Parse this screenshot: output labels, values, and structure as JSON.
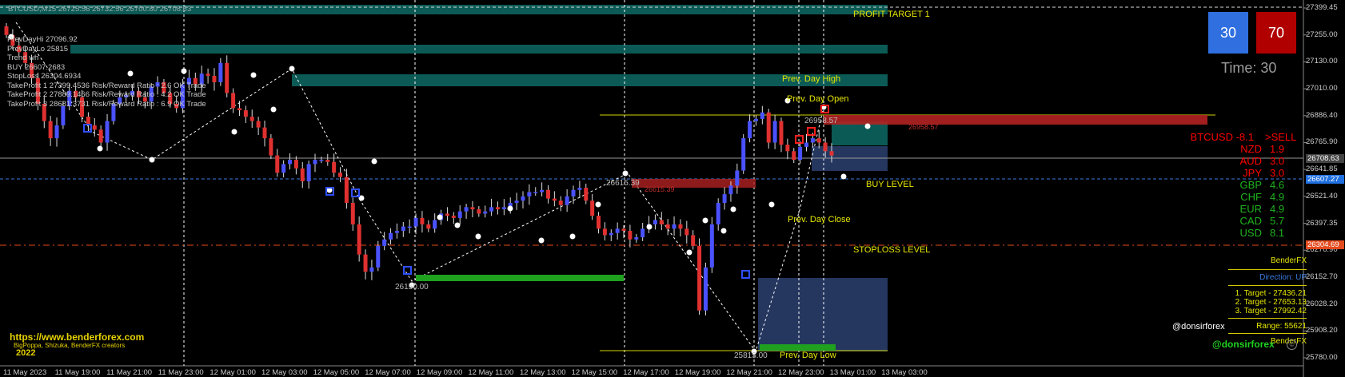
{
  "window": {
    "top_info": "BTCUSD,M15 26725.56 26732.56 26700.80 26708.63"
  },
  "indicator_text": {
    "lines": [
      "PrevDayHi 27096.92",
      "PrevDayLo 25815",
      "Trend wh",
      "BUY 26607.2683",
      "StopLoss 26304.6934",
      "TakeProfit 1 27399.4536 Risk/Reward Ratio : 2.6 OK Trade",
      "TakeProfit 2 27889.1466 Risk/Reward Ratio : 4.2 OK Trade",
      "TakeProfit 3 28681.3731 Risk/Reward Ratio : 6.9 OK Trade"
    ]
  },
  "levels": {
    "profit_target_label": "PROFIT TARGET 1",
    "prev_day_high_label": "Prev. Day High",
    "prev_day_open_label": "Prev. Day Open",
    "prev_day_close_label": "Prev. Day Close",
    "prev_day_low_label": "Prev. Day Low",
    "buy_level_label": "BUY LEVEL",
    "stoploss_label": "STOPLOSS LEVEL"
  },
  "zigzag_labels": {
    "high_1": "26958.57",
    "high_2": "26615.39",
    "low_1": "26150.00",
    "low_2": "25815.00"
  },
  "signal_text": {
    "sell_cluster": "26958.57",
    "mid_cluster": "26615.39"
  },
  "timer": {
    "buy_count": "30",
    "sell_count": "70",
    "time_label": "Time: 30",
    "buy_color": "#2f6fe0",
    "sell_color": "#b00000"
  },
  "strength": [
    {
      "name": "BTCUSD -8.1",
      "value": ">SELL",
      "color": "#ff0000"
    },
    {
      "name": "NZD",
      "value": "1.9",
      "color": "#ff0000"
    },
    {
      "name": "AUD",
      "value": "3.0",
      "color": "#ff0000"
    },
    {
      "name": "JPY",
      "value": "3.0",
      "color": "#ff0000"
    },
    {
      "name": "GBP",
      "value": "4.6",
      "color": "#1fb21f"
    },
    {
      "name": "CHF",
      "value": "4.9",
      "color": "#1fb21f"
    },
    {
      "name": "EUR",
      "value": "4.9",
      "color": "#1fb21f"
    },
    {
      "name": "CAD",
      "value": "5.7",
      "color": "#1fb21f"
    },
    {
      "name": "USD",
      "value": "8.1",
      "color": "#1fb21f"
    }
  ],
  "benderfx": {
    "title": "BenderFX",
    "direction": "Direction: UP",
    "target1": "1. Target - 27436.21",
    "target2": "2. Target - 27653.13",
    "target3": "3. Target - 27992.42",
    "range": "Range: 55621",
    "footer": "BenderFX",
    "handle_white": "@donsirforex",
    "handle_green": "@donsirforex"
  },
  "branding": {
    "url": "https://www.benderforex.com",
    "creators": "BigPoppa, Shizuka, BenderFX creators",
    "year": "2022"
  },
  "price_axis": {
    "labels": [
      "27399.45",
      "27255.00",
      "27130.00",
      "27010.00",
      "26886.40",
      "26765.90",
      "26641.85",
      "26521.40",
      "26397.35",
      "26276.90",
      "26152.70",
      "26028.20",
      "25908.20",
      "25780.00"
    ],
    "current_price": "26708.63",
    "buy_price": "26607.27",
    "stop_price": "26304.69"
  },
  "time_axis": {
    "labels": [
      "11 May 2023",
      "11 May 19:00",
      "11 May 21:00",
      "11 May 23:00",
      "12 May 01:00",
      "12 May 03:00",
      "12 May 05:00",
      "12 May 07:00",
      "12 May 09:00",
      "12 May 11:00",
      "12 May 13:00",
      "12 May 15:00",
      "12 May 17:00",
      "12 May 19:00",
      "12 May 21:00",
      "12 May 23:00",
      "13 May 01:00",
      "13 May 03:00"
    ]
  },
  "chart_data": {
    "type": "candlestick",
    "symbol": "BTCUSD",
    "timeframe": "M15",
    "ylim": [
      25780,
      27420
    ],
    "close_path": [
      27280,
      27230,
      27200,
      27150,
      27080,
      26960,
      26880,
      26800,
      26860,
      26950,
      27020,
      26990,
      26900,
      26860,
      26840,
      26780,
      26880,
      26960,
      26990,
      27000,
      27020,
      26990,
      26970,
      27040,
      27060,
      27010,
      26960,
      26940,
      27050,
      27080,
      27050,
      27100,
      27090,
      27060,
      27150,
      27010,
      26940,
      26930,
      26900,
      26880,
      26850,
      26800,
      26720,
      26640,
      26680,
      26700,
      26660,
      26600,
      26680,
      26700,
      26700,
      26690,
      26640,
      26620,
      26500,
      26400,
      26260,
      26180,
      26200,
      26300,
      26330,
      26360,
      26370,
      26390,
      26390,
      26430,
      26400,
      26380,
      26420,
      26450,
      26440,
      26430,
      26460,
      26480,
      26470,
      26450,
      26460,
      26480,
      26470,
      26480,
      26500,
      26510,
      26530,
      26550,
      26550,
      26560,
      26520,
      26510,
      26490,
      26530,
      26560,
      26570,
      26510,
      26440,
      26380,
      26350,
      26360,
      26380,
      26370,
      26330,
      26340,
      26380,
      26400,
      26420,
      26400,
      26380,
      26400,
      26380,
      26350,
      26300,
      26000,
      26200,
      26400,
      26500,
      26540,
      26580,
      26650,
      26800,
      26880,
      26890,
      26920,
      26780,
      26880,
      26770,
      26740,
      26700,
      26760,
      26780,
      26800,
      26780,
      26740,
      26720
    ]
  }
}
